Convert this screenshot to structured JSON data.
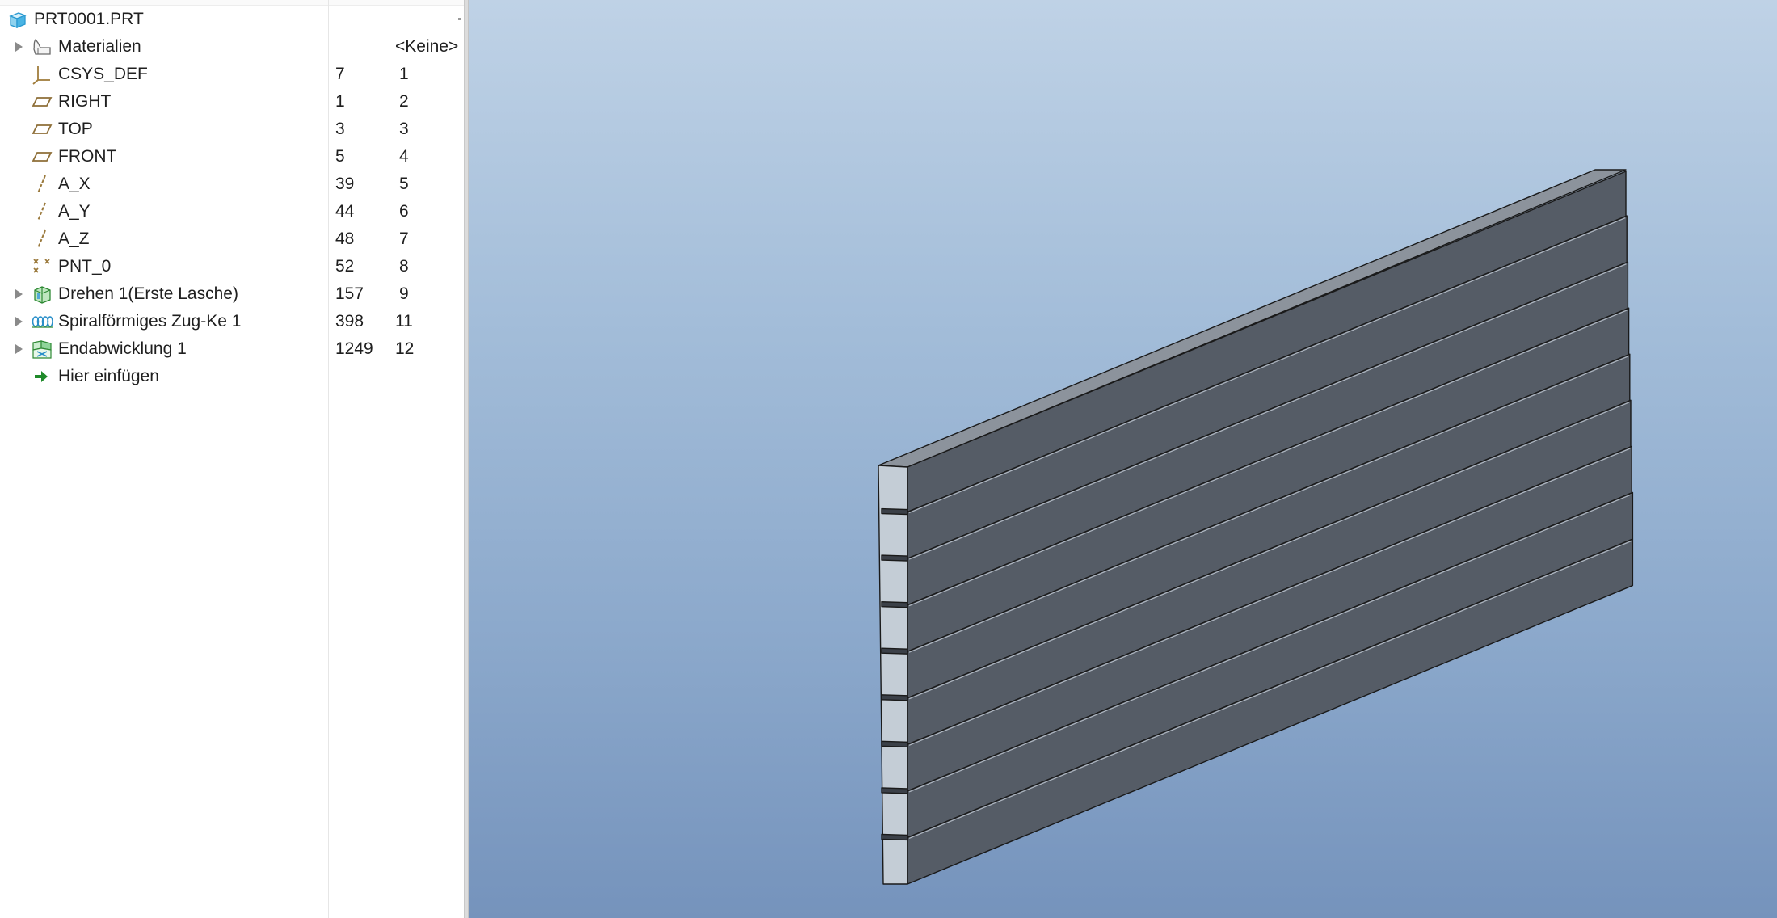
{
  "model_tree": {
    "root": {
      "label": "PRT0001.PRT",
      "icon": "part-icon"
    },
    "rows": [
      {
        "label": "Materialien",
        "icon": "material-icon",
        "expandable": true,
        "col1": "",
        "col2": "<Keine>"
      },
      {
        "label": "CSYS_DEF",
        "icon": "csys-icon",
        "expandable": false,
        "col1": "7",
        "col2": "1"
      },
      {
        "label": "RIGHT",
        "icon": "datum-plane-icon",
        "expandable": false,
        "col1": "1",
        "col2": "2"
      },
      {
        "label": "TOP",
        "icon": "datum-plane-icon",
        "expandable": false,
        "col1": "3",
        "col2": "3"
      },
      {
        "label": "FRONT",
        "icon": "datum-plane-icon",
        "expandable": false,
        "col1": "5",
        "col2": "4"
      },
      {
        "label": "A_X",
        "icon": "datum-axis-icon",
        "expandable": false,
        "col1": "39",
        "col2": "5"
      },
      {
        "label": "A_Y",
        "icon": "datum-axis-icon",
        "expandable": false,
        "col1": "44",
        "col2": "6"
      },
      {
        "label": "A_Z",
        "icon": "datum-axis-icon",
        "expandable": false,
        "col1": "48",
        "col2": "7"
      },
      {
        "label": "PNT_0",
        "icon": "datum-point-icon",
        "expandable": false,
        "col1": "52",
        "col2": "8"
      },
      {
        "label": "Drehen 1(Erste Lasche)",
        "icon": "revolve-wall-icon",
        "expandable": true,
        "col1": "157",
        "col2": "9"
      },
      {
        "label": "Spiralförmiges Zug-Ke 1",
        "icon": "helical-sweep-icon",
        "expandable": true,
        "col1": "398",
        "col2": "11"
      },
      {
        "label": "Endabwicklung 1",
        "icon": "flat-pattern-icon",
        "expandable": true,
        "col1": "1249",
        "col2": "12"
      },
      {
        "label": "Hier einfügen",
        "icon": "insert-here-arrow-icon",
        "expandable": false,
        "col1": "",
        "col2": ""
      }
    ]
  },
  "viewport": {
    "model": "flattened sheetmetal part",
    "colors": {
      "background_top": "#bfd2e6",
      "background_bottom": "#7593bc",
      "face_dark": "#555c66",
      "face_light": "#c4cdd6",
      "face_top": "#8c939c",
      "edge": "#1a1a1a"
    }
  }
}
